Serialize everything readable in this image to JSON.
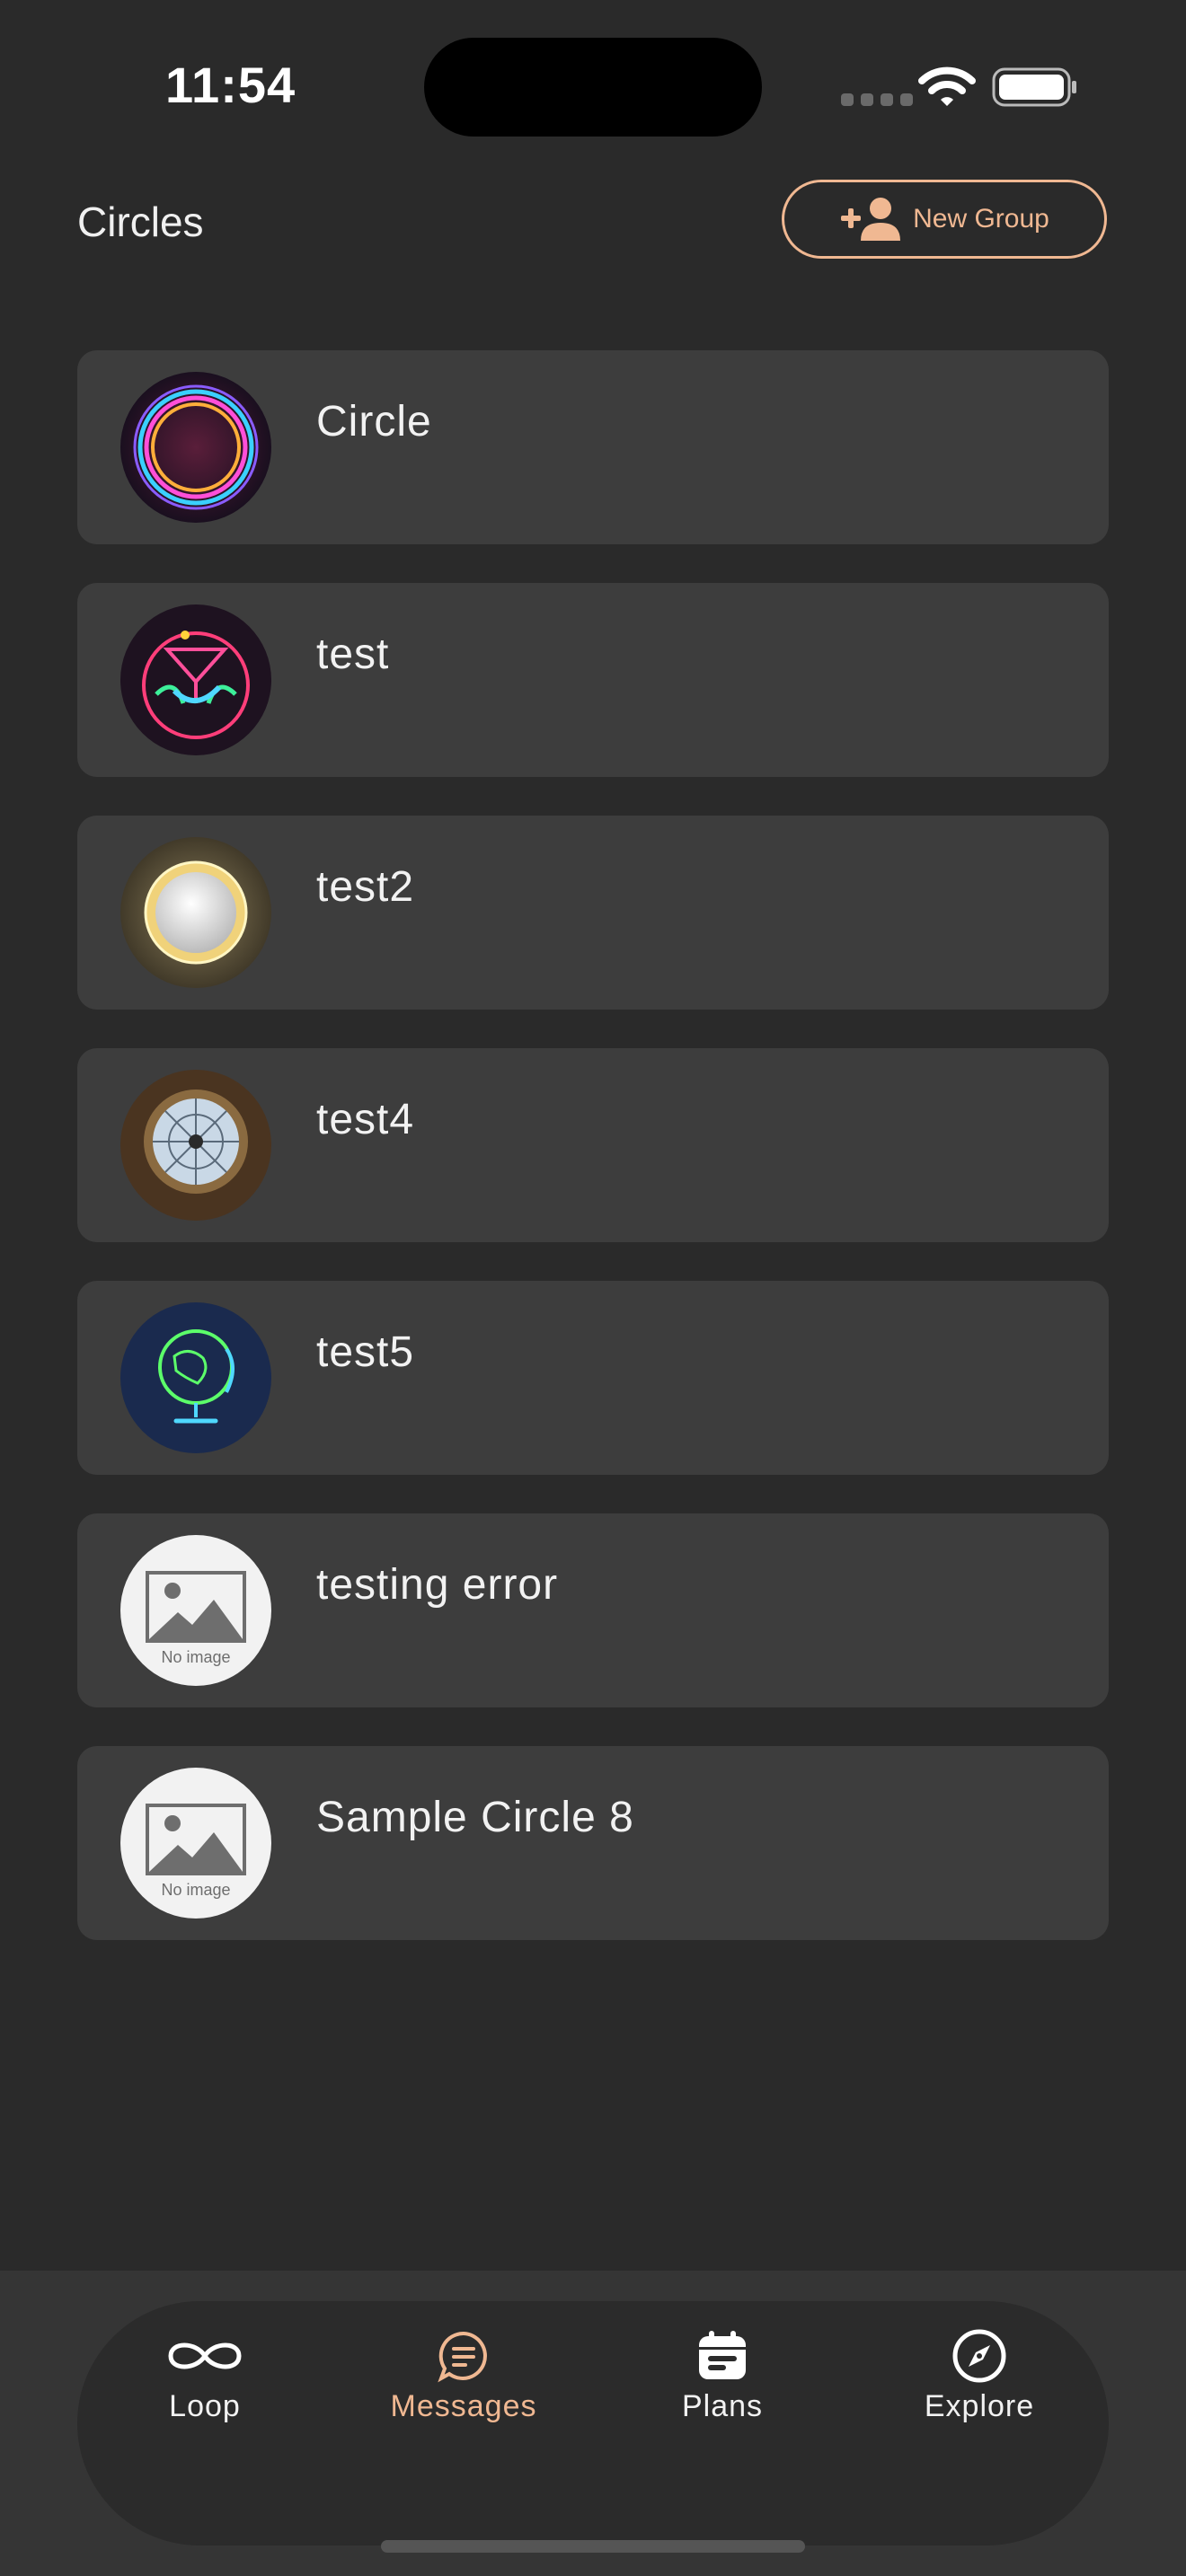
{
  "status_bar": {
    "time": "11:54"
  },
  "header": {
    "title": "Circles",
    "new_group_label": "New Group"
  },
  "circles": [
    {
      "name": "Circle",
      "avatar": "neon-ring-image"
    },
    {
      "name": "test",
      "avatar": "jazz-bar-neon-image"
    },
    {
      "name": "test2",
      "avatar": "gold-ring-image"
    },
    {
      "name": "test4",
      "avatar": "dome-window-image"
    },
    {
      "name": "test5",
      "avatar": "neon-globe-image"
    },
    {
      "name": "testing error",
      "avatar": "no-image-placeholder",
      "placeholder_text": "No image"
    },
    {
      "name": "Sample Circle 8",
      "avatar": "no-image-placeholder",
      "placeholder_text": "No image"
    }
  ],
  "tabs": [
    {
      "label": "Loop",
      "icon": "infinity-icon",
      "active": false
    },
    {
      "label": "Messages",
      "icon": "chat-bubble-icon",
      "active": true
    },
    {
      "label": "Plans",
      "icon": "calendar-icon",
      "active": false
    },
    {
      "label": "Explore",
      "icon": "compass-icon",
      "active": false
    }
  ],
  "colors": {
    "background": "#2a2a2a",
    "card": "#3d3d3d",
    "accent": "#f0b892"
  }
}
